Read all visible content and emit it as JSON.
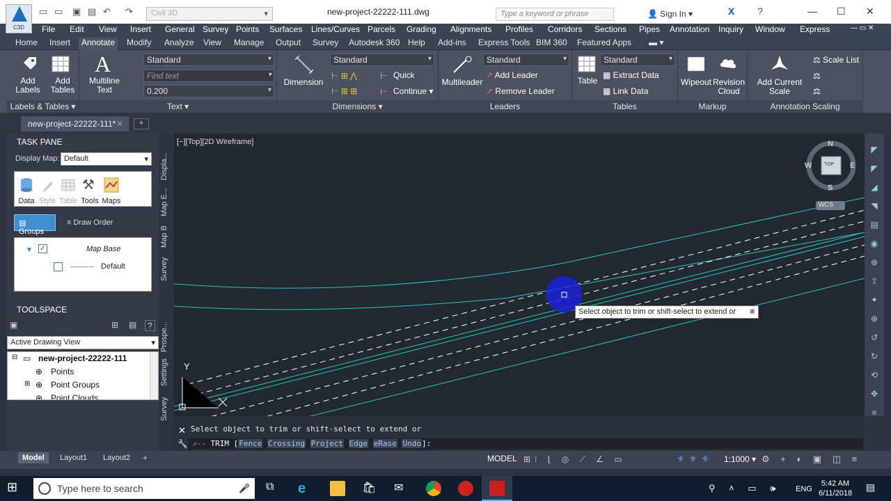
{
  "window": {
    "workspace": "Civil 3D",
    "title": "new-project-22222-111.dwg",
    "search_placeholder": "Type a keyword or phrase",
    "sign_in": "Sign In",
    "app_badge": "C3D"
  },
  "menubar": [
    "File",
    "Edit",
    "View",
    "Insert",
    "General",
    "Survey",
    "Points",
    "Surfaces",
    "Lines/Curves",
    "Parcels",
    "Grading",
    "Alignments",
    "Profiles",
    "Corridors",
    "Sections",
    "Pipes",
    "Annotation",
    "Inquiry",
    "Window",
    "Express"
  ],
  "ribbon_tabs": [
    "Home",
    "Insert",
    "Annotate",
    "Modify",
    "Analyze",
    "View",
    "Manage",
    "Output",
    "Survey",
    "Autodesk 360",
    "Help",
    "Add-ins",
    "Express Tools",
    "BIM 360",
    "Featured Apps"
  ],
  "ribbon": {
    "labels_tables": {
      "add_labels": "Add Labels",
      "add_tables": "Add Tables",
      "title": "Labels & Tables"
    },
    "text": {
      "multiline": "Multiline Text",
      "style": "Standard",
      "find_placeholder": "Find text",
      "height": "0.200",
      "title": "Text"
    },
    "dimensions": {
      "dimension": "Dimension",
      "style": "Standard",
      "quick": "Quick",
      "continue": "Continue",
      "title": "Dimensions"
    },
    "leaders": {
      "multileader": "Multileader",
      "style": "Standard",
      "add_leader": "Add Leader",
      "remove_leader": "Remove Leader",
      "title": "Leaders"
    },
    "tables": {
      "table": "Table",
      "style": "Standard",
      "extract": "Extract Data",
      "link": "Link Data",
      "title": "Tables"
    },
    "markup": {
      "wipeout": "Wipeout",
      "revision": "Revision Cloud",
      "title": "Markup"
    },
    "scaling": {
      "add_scale": "Add Current Scale",
      "scale_list": "Scale List",
      "title": "Annotation Scaling"
    }
  },
  "doc_tab": "new-project-22222-111*",
  "task_pane": {
    "title": "TASK PANE",
    "display_map_label": "Display Map:",
    "display_map": "Default",
    "icons": [
      "Data",
      "Style",
      "Table",
      "Tools",
      "Maps"
    ],
    "groups": "Groups",
    "draw_order": "Draw Order",
    "layer_group": "Map Base",
    "layer_item": "Default",
    "side_tabs": [
      "Displa...",
      "Map E...",
      "Map B",
      "Survey"
    ]
  },
  "toolspace": {
    "title": "TOOLSPACE",
    "view": "Active Drawing View",
    "tree": [
      "new-project-22222-111",
      "Points",
      "Point Groups",
      "Point Clouds"
    ],
    "side_tabs": [
      "Prospe...",
      "Settings",
      "Survey"
    ]
  },
  "viewport": {
    "label": "[−][Top][2D Wireframe]",
    "compass": {
      "n": "N",
      "s": "S",
      "e": "E",
      "w": "W",
      "top": "TOP"
    },
    "wcs": "WCS",
    "tooltip": "Select object to trim or shift-select to extend or",
    "axis_y": "Y"
  },
  "command": {
    "history": "Select object to trim or shift-select to extend or",
    "prefix": "TRIM [",
    "options": [
      "Fence",
      "Crossing",
      "Project",
      "Edge",
      "eRase",
      "Undo"
    ],
    "suffix": "]:"
  },
  "layout_tabs": [
    "Model",
    "Layout1",
    "Layout2"
  ],
  "status": {
    "model": "MODEL",
    "scale": "1:1000"
  },
  "taskbar": {
    "search": "Type here to search",
    "lang": "ENG",
    "time": "5:42 AM",
    "date": "6/11/2018"
  },
  "colors": {
    "canvas": "#212830",
    "accent": "#3e8fd0",
    "cyan_lines": "#2bc4c4"
  }
}
